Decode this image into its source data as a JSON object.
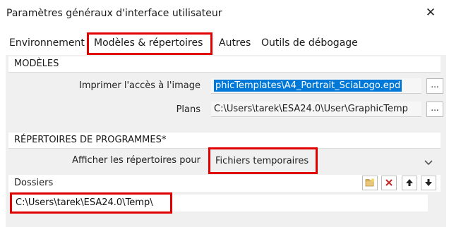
{
  "window": {
    "title": "Paramètres généraux d'interface utilisateur",
    "close_glyph": "✕"
  },
  "tabs": [
    {
      "label": "Environnement",
      "selected": false
    },
    {
      "label": "Modèles & répertoires",
      "selected": true
    },
    {
      "label": "Autres",
      "selected": false
    },
    {
      "label": "Outils de débogage",
      "selected": false
    }
  ],
  "models": {
    "header": "MODÈLES",
    "print_label": "Imprimer l'accès à l'image",
    "print_value": "phicTemplates\\A4_Portrait_SciaLogo.epd",
    "plans_label": "Plans",
    "plans_value": "C:\\Users\\tarek\\ESA24.0\\User\\GraphicTemp",
    "browse_label": "..."
  },
  "program_dirs": {
    "header": "RÉPERTOIRES DE PROGRAMMES*",
    "show_label": "Afficher les répertoires pour",
    "show_value": "Fichiers temporaires"
  },
  "folders": {
    "label": "Dossiers",
    "items": [
      "C:\\Users\\tarek\\ESA24.0\\Temp\\"
    ],
    "toolbar_icons": [
      "add-folder-icon",
      "delete-icon",
      "move-up-icon",
      "move-down-icon"
    ]
  },
  "colors": {
    "highlight": "#e00000",
    "selection": "#0078d7",
    "delete": "#c62828"
  }
}
